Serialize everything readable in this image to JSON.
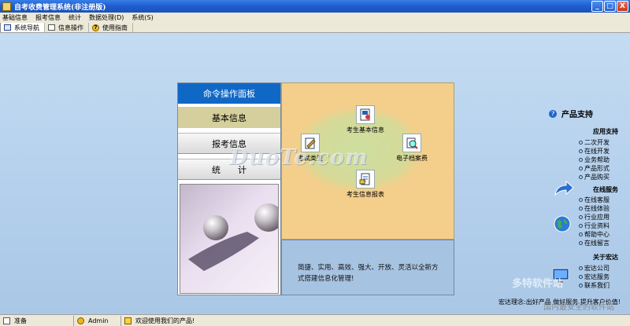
{
  "window": {
    "title": "自考收费管理系统(非注册版)",
    "buttons": {
      "minimize": "_",
      "maximize": "□",
      "close": "X"
    }
  },
  "menu": [
    "基础信息",
    "报考信息",
    "统计",
    "数据处理(D)",
    "系统(S)"
  ],
  "tabs": [
    {
      "label": "系统导航",
      "icon": "monitor-icon"
    },
    {
      "label": "信息操作",
      "icon": "document-icon"
    },
    {
      "label": "使用指南",
      "icon": "help-icon"
    }
  ],
  "command_panel": {
    "header": "命令操作面板",
    "buttons": [
      "基本信息",
      "报考信息",
      "统计"
    ]
  },
  "diagram": {
    "nodes": {
      "top": "考生基本信息",
      "left": "考试类型",
      "right": "电子档案费",
      "bottom": "考生信息报表"
    },
    "slogan": "简捷、实用、高效、强大、开放、灵活以全新方式搭建信息化管理!"
  },
  "watermark": "DuoTe.com",
  "support": {
    "title": "产品支持",
    "sections": [
      {
        "title": "应用支持",
        "links": [
          "二次开发",
          "在线开发",
          "业务帮助",
          "产品形式",
          "产品购买"
        ]
      },
      {
        "title": "在线服务",
        "links": [
          "在线客服",
          "在线体验",
          "行业应用",
          "行业资料",
          "帮助中心",
          "在线留言"
        ]
      },
      {
        "title": "关于宏达",
        "links": [
          "宏达公司",
          "宏达服务",
          "联系我们"
        ]
      }
    ],
    "philosophy": "宏达理念:出好产品 做好服务 提升客户价值!",
    "corner_watermark": "多特软件站",
    "corner_watermark_2": "国内最安全的软件站"
  },
  "status": {
    "state": "准备",
    "user": "Admin",
    "message": "欢迎使用我们的产品!"
  },
  "colors": {
    "titlebar": "#1f5fd0",
    "command_header": "#1068c6",
    "diagram_panel": "#f4cf8c",
    "slogan_panel": "#a7c3e2",
    "main_bg": "#b8d4ee"
  }
}
